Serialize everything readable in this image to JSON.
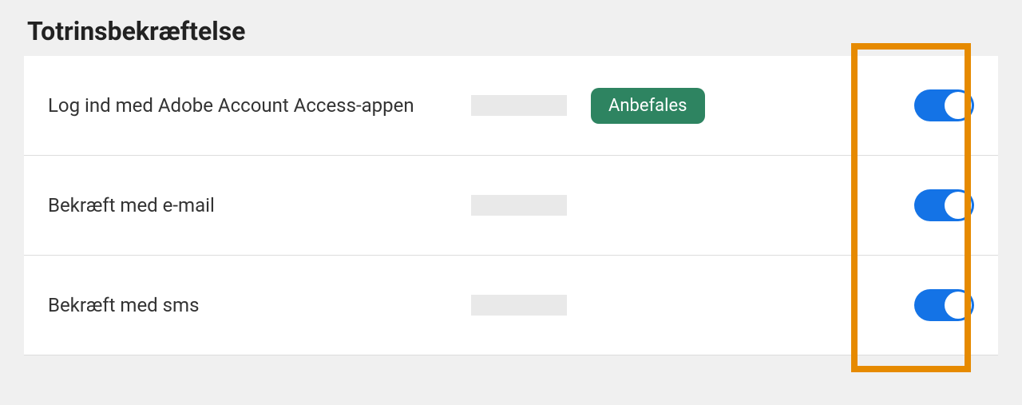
{
  "section": {
    "title": "Totrinsbekræftelse"
  },
  "rows": [
    {
      "label": "Log ind med Adobe Account Access-appen",
      "badge": "Anbefales",
      "has_badge": true,
      "toggle_on": true
    },
    {
      "label": "Bekræft med e-mail",
      "has_badge": false,
      "toggle_on": true
    },
    {
      "label": "Bekræft med sms",
      "has_badge": false,
      "toggle_on": true
    }
  ],
  "colors": {
    "badge_bg": "#2e8461",
    "toggle_on": "#1473e6",
    "highlight_border": "#e68a00"
  }
}
